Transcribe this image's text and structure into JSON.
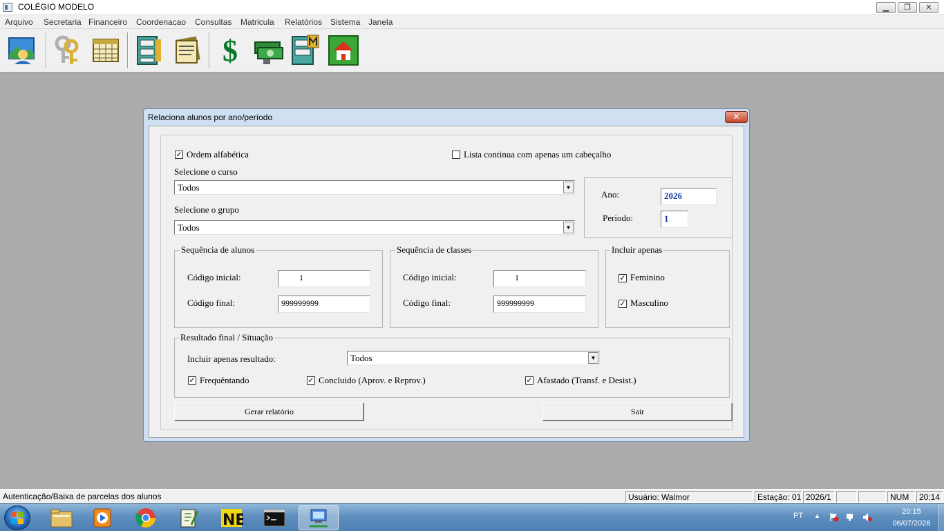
{
  "window": {
    "title": "COLÉGIO MODELO",
    "minimize": "▁",
    "restore": "❐",
    "close": "✕"
  },
  "menu": [
    "Arquivo",
    "Secretaria",
    "Financeiro",
    "Coordenacao",
    "Consultas",
    "Matricula",
    "Relatórios",
    "Sistema",
    "Janela"
  ],
  "toolbar": {
    "icons": [
      "landscape-user-icon",
      "keys-icon",
      "calendar-icon",
      "file-cabinet-icon",
      "documents-icon",
      "dollar-icon",
      "money-icon",
      "file-cabinet-m-icon",
      "home-icon"
    ],
    "dollar_glyph": "$"
  },
  "dialog": {
    "title": "Relaciona alunos por ano/período",
    "close": "✕",
    "ordem_alfabetica": {
      "label": "Ordem alfabética",
      "checked": "✓"
    },
    "lista_continua": {
      "label": "Lista continua com apenas um cabeçalho",
      "checked": ""
    },
    "curso": {
      "label": "Selecione o curso",
      "value": "Todos"
    },
    "grupo": {
      "label": "Selecione o grupo",
      "value": "Todos"
    },
    "ano": {
      "label": "Ano:",
      "value": "2026"
    },
    "periodo": {
      "label": "Periodo:",
      "value": "1"
    },
    "seq_alunos": {
      "title": "Sequência de alunos",
      "inicial_label": "Código inicial:",
      "inicial_value": "1",
      "final_label": "Código final:",
      "final_value": "999999999"
    },
    "seq_classes": {
      "title": "Sequência de classes",
      "inicial_label": "Código inicial:",
      "inicial_value": "1",
      "final_label": "Código final:",
      "final_value": "999999999"
    },
    "incluir": {
      "title": "Incluir apenas",
      "feminino": {
        "label": "Feminino",
        "checked": "✓"
      },
      "masculino": {
        "label": "Masculino",
        "checked": "✓"
      }
    },
    "resultado": {
      "title": "Resultado final / Situação",
      "incluir_label": "Incluir apenas resultado:",
      "incluir_value": "Todos",
      "frequentando": {
        "label": "Frequêntando",
        "checked": "✓"
      },
      "concluido": {
        "label": "Concluido (Aprov. e Reprov.)",
        "checked": "✓"
      },
      "afastado": {
        "label": "Afastado (Transf. e Desist.)",
        "checked": "✓"
      }
    },
    "gerar": "Gerar relatório",
    "sair": "Sair",
    "arrow": "▼"
  },
  "status": {
    "message": "Autenticação/Baixa de parcelas dos alunos",
    "usuario": "Usuário: Walmor",
    "estacao": "Estação: 01",
    "periodo": "2026/1",
    "empty1": "",
    "empty2": "",
    "num": "NUM",
    "time": "20:14"
  },
  "taskbar": {
    "apps": [
      "explorer-icon",
      "media-player-icon",
      "chrome-icon",
      "notepadpp-icon",
      "nero-icon",
      "cmd-icon",
      "network-app-icon"
    ],
    "lang": "PT",
    "clock_time": "20:15",
    "clock_date": "06/07/2026",
    "tray_up": "▲"
  }
}
